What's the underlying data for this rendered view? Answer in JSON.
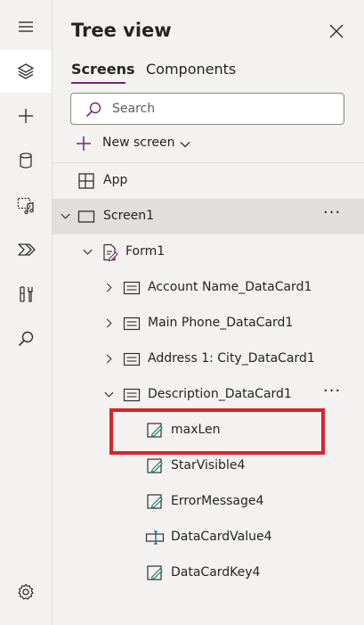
{
  "rail": {
    "items": [
      {
        "icon": "hamburger-menu-icon"
      },
      {
        "icon": "layers-icon",
        "active": true
      },
      {
        "icon": "plus-icon"
      },
      {
        "icon": "database-icon"
      },
      {
        "icon": "media-icon"
      },
      {
        "icon": "power-automate-icon"
      },
      {
        "icon": "advanced-tools-icon"
      },
      {
        "icon": "search-icon"
      },
      {
        "icon": "settings-gear-icon"
      }
    ]
  },
  "panel": {
    "title": "Tree view",
    "tabs": [
      "Screens",
      "Components"
    ],
    "active_tab": "Screens",
    "search_placeholder": "Search",
    "new_screen_label": "New screen"
  },
  "tree": {
    "app": "App",
    "screen": "Screen1",
    "form": "Form1",
    "cards": [
      "Account Name_DataCard1",
      "Main Phone_DataCard1",
      "Address 1: City_DataCard1",
      "Description_DataCard1"
    ],
    "children": [
      "maxLen",
      "StarVisible4",
      "ErrorMessage4",
      "DataCardValue4",
      "DataCardKey4"
    ],
    "more_label": "···"
  },
  "colors": {
    "accent": "#742774",
    "highlight": "#d9232b",
    "selected_row": "#e1dfdd",
    "panel_bg": "#f3f2f1"
  }
}
